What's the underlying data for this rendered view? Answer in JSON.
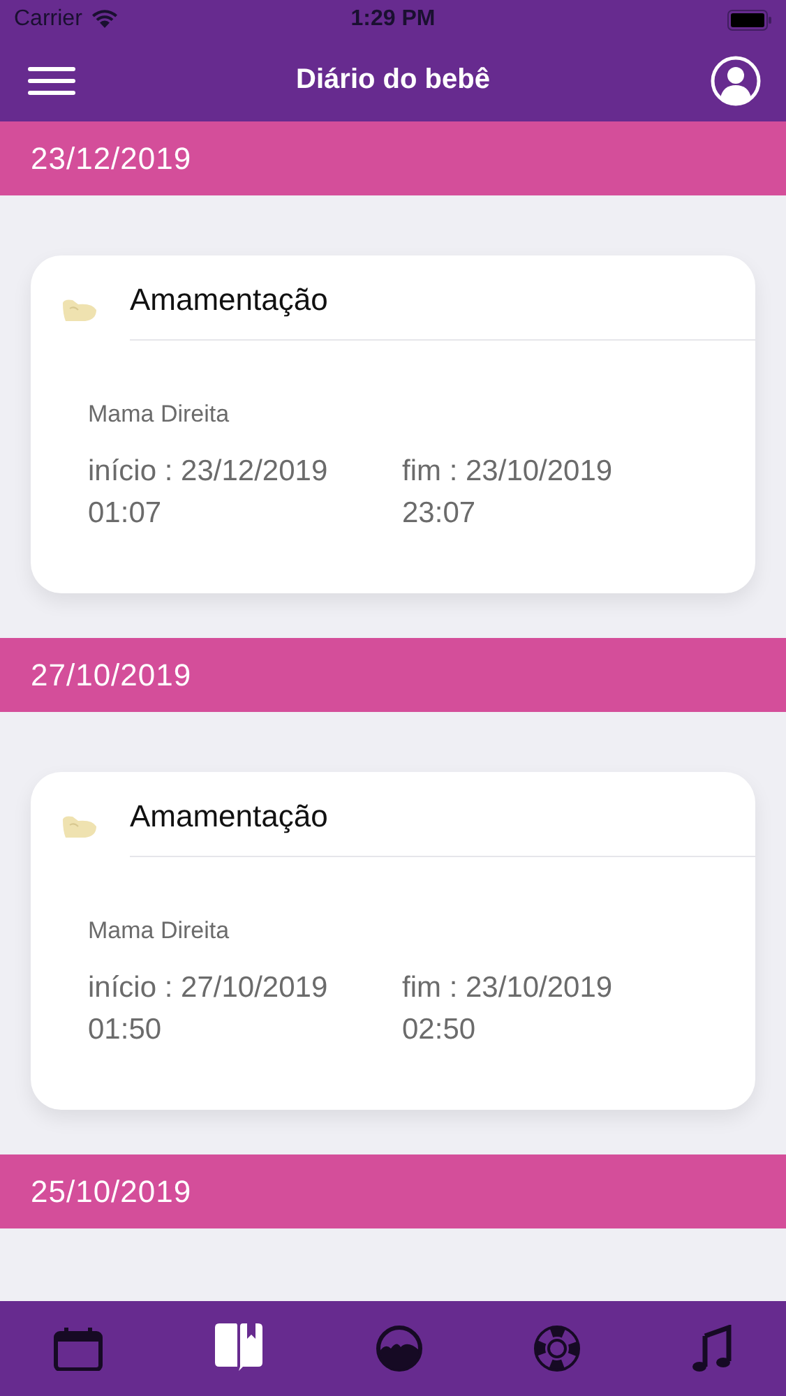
{
  "status_bar": {
    "carrier": "Carrier",
    "time": "1:29 PM"
  },
  "nav": {
    "title": "Diário do bebê"
  },
  "entries": [
    {
      "date": "23/12/2019",
      "card": {
        "title": "Amamentação",
        "side": "Mama Direita",
        "start": "início : 23/12/2019 01:07",
        "end": "fim : 23/10/2019 23:07"
      }
    },
    {
      "date": "27/10/2019",
      "card": {
        "title": "Amamentação",
        "side": "Mama Direita",
        "start": "início : 27/10/2019 01:50",
        "end": "fim : 23/10/2019 02:50"
      }
    },
    {
      "date": "25/10/2019"
    }
  ],
  "tabs": [
    {
      "kind": "calendar",
      "selected": false
    },
    {
      "kind": "book",
      "selected": true
    },
    {
      "kind": "landscape",
      "selected": false
    },
    {
      "kind": "lifebuoy",
      "selected": false
    },
    {
      "kind": "music",
      "selected": false
    }
  ]
}
